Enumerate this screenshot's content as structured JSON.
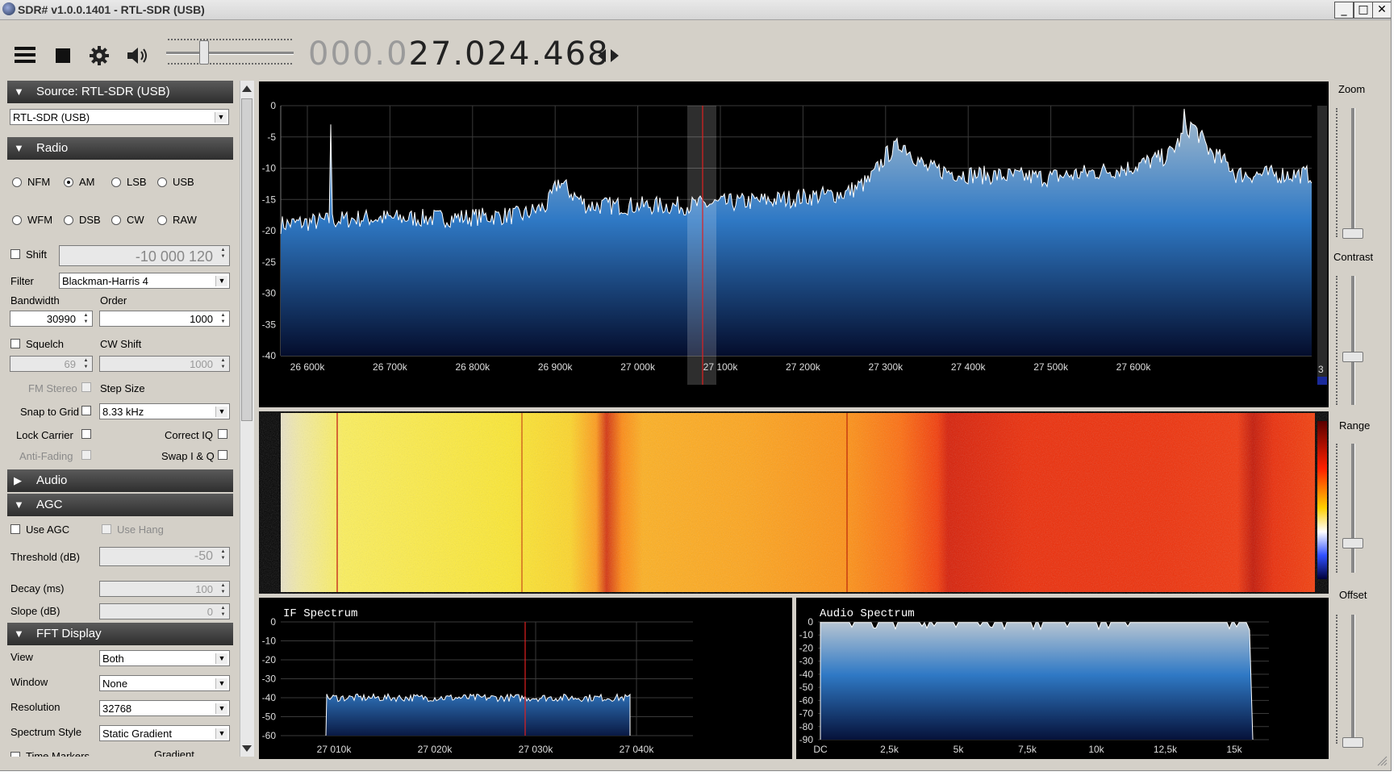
{
  "window": {
    "title": "SDR# v1.0.0.1401 - RTL-SDR (USB)",
    "btn_min": "_",
    "btn_max": "□",
    "btn_close": "✕"
  },
  "toolbar": {
    "icons": [
      "menu-icon",
      "stop-icon",
      "gear-icon",
      "speaker-icon",
      "swap-arrows-icon"
    ],
    "frequency_dim": "000.0",
    "frequency_main": "27.024.468",
    "volume_level": 0.28
  },
  "source": {
    "header": "Source: RTL-SDR (USB)",
    "device": "RTL-SDR (USB)"
  },
  "radio": {
    "header": "Radio",
    "modes": [
      "NFM",
      "AM",
      "LSB",
      "USB",
      "WFM",
      "DSB",
      "CW",
      "RAW"
    ],
    "selected_mode": "AM",
    "shift_label": "Shift",
    "shift_value": "-10 000 120",
    "filter_label": "Filter",
    "filter_value": "Blackman-Harris 4",
    "bandwidth_label": "Bandwidth",
    "bandwidth_value": "30990",
    "order_label": "Order",
    "order_value": "1000",
    "squelch_label": "Squelch",
    "squelch_value": "69",
    "cwshift_label": "CW Shift",
    "cwshift_value": "1000",
    "fmstereo_label": "FM Stereo",
    "stepsize_label": "Step Size",
    "snap_label": "Snap to Grid",
    "snap_value": "8.33 kHz",
    "lockcarrier_label": "Lock Carrier",
    "correctiq_label": "Correct IQ",
    "antifading_label": "Anti-Fading",
    "swapiq_label": "Swap I & Q"
  },
  "audio": {
    "header": "Audio"
  },
  "agc": {
    "header": "AGC",
    "useagc_label": "Use AGC",
    "usehang_label": "Use Hang",
    "threshold_label": "Threshold (dB)",
    "threshold_value": "-50",
    "decay_label": "Decay (ms)",
    "decay_value": "100",
    "slope_label": "Slope (dB)",
    "slope_value": "0"
  },
  "fft": {
    "header": "FFT Display",
    "view_label": "View",
    "view_value": "Both",
    "window_label": "Window",
    "window_value": "None",
    "resolution_label": "Resolution",
    "resolution_value": "32768",
    "style_label": "Spectrum Style",
    "style_value": "Static Gradient",
    "timemarkers_label": "Time Markers",
    "gradient_label": "Gradient"
  },
  "main_spectrum": {
    "y_ticks": [
      "0",
      "-5",
      "-10",
      "-15",
      "-20",
      "-25",
      "-30",
      "-35",
      "-40"
    ],
    "x_ticks": [
      "26 600k",
      "26 700k",
      "26 800k",
      "26 900k",
      "27 000k",
      "27 100k",
      "27 200k",
      "27 300k",
      "27 400k",
      "27 500k",
      "27 600k"
    ],
    "side_value": "3"
  },
  "if_spectrum": {
    "title": "IF Spectrum",
    "y_ticks": [
      "0",
      "-10",
      "-20",
      "-30",
      "-40",
      "-50",
      "-60"
    ],
    "x_ticks": [
      "27 010k",
      "27 020k",
      "27 030k",
      "27 040k"
    ]
  },
  "audio_spectrum": {
    "title": "Audio Spectrum",
    "y_ticks": [
      "0",
      "-10",
      "-20",
      "-30",
      "-40",
      "-50",
      "-60",
      "-70",
      "-80",
      "-90"
    ],
    "x_ticks": [
      "DC",
      "2,5k",
      "5k",
      "7,5k",
      "10k",
      "12,5k",
      "15k"
    ]
  },
  "right_controls": {
    "zoom_label": "Zoom",
    "contrast_label": "Contrast",
    "range_label": "Range",
    "offset_label": "Offset"
  },
  "colors": {
    "spectrum_fill_top": "#8fb4cf",
    "spectrum_fill_bottom": "#061235",
    "waterfall_hot": "#ff2a00",
    "waterfall_warm": "#ffd400",
    "marker": "#e02020"
  }
}
